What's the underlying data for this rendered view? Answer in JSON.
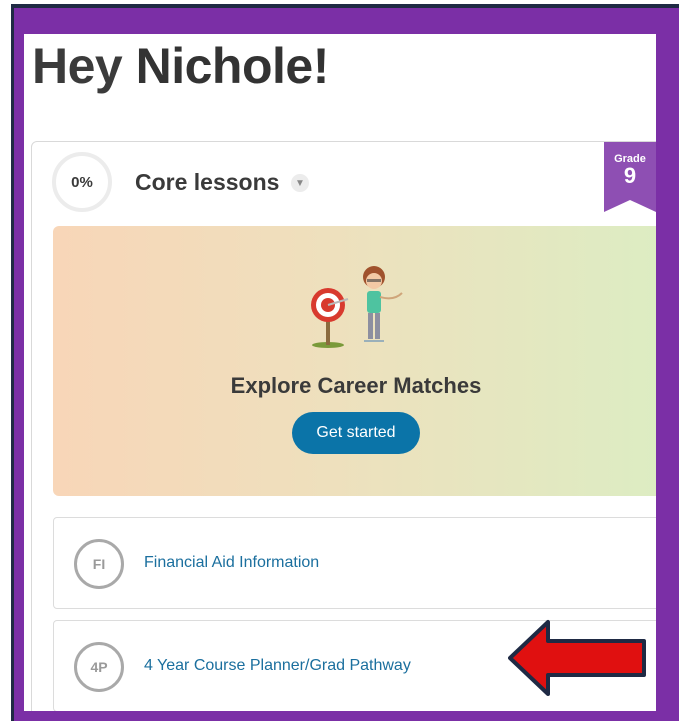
{
  "greeting": {
    "prefix": "Hey ",
    "name": "Nichole!"
  },
  "core_lessons": {
    "progress": "0%",
    "title": "Core lessons",
    "chevron_icon": "chevron-down-icon"
  },
  "grade": {
    "label": "Grade",
    "value": "9"
  },
  "hero": {
    "title": "Explore Career Matches",
    "button_label": "Get started",
    "button_color": "#0b74a8"
  },
  "lessons": [
    {
      "badge": "FI",
      "title": "Financial Aid Information"
    },
    {
      "badge": "4P",
      "title": "4 Year Course Planner/Grad Pathway"
    }
  ],
  "colors": {
    "frame_border": "#7b2fa6",
    "link": "#1b6f9e",
    "grade_ribbon": "#8e4fb3",
    "arrow_fill": "#e01010",
    "arrow_outline": "#1f2a44"
  }
}
